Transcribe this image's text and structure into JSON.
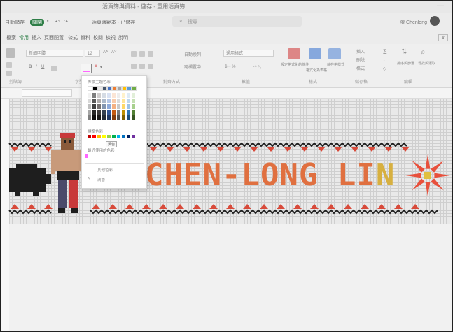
{
  "window": {
    "title": "活頁簿與資料 - 儲存 - 重用活頁簿"
  },
  "quickbar": {
    "autosave": "自動儲存",
    "toggle": "關閉",
    "filename": "活頁簿範本 - 已儲存",
    "search_placeholder": "搜尋",
    "user": "陳 Chenlong"
  },
  "tabs": [
    "檔案",
    "常用",
    "插入",
    "頁面配置",
    "公式",
    "資料",
    "校閱",
    "檢視",
    "說明"
  ],
  "ribbon": {
    "font_name": "新細明體",
    "font_size": "12",
    "number_format": "通用格式",
    "groups": [
      "剪貼簿",
      "字型",
      "對齊方式",
      "數值",
      "樣式",
      "儲存格",
      "編輯"
    ],
    "wrap_text": "自動換列",
    "merge": "跨欄置中",
    "cond_format": "設定格式化的條件",
    "format_table": "格式化為表格",
    "cell_styles": "儲存格樣式",
    "insert": "插入",
    "delete": "刪除",
    "format": "格式",
    "sort_filter": "排序與篩選",
    "find_select": "尋找與選取"
  },
  "color_panel": {
    "theme_colors_label": "佈景主題色彩",
    "standard_colors_label": "標準色彩",
    "recent_colors_label": "最近使用的色彩",
    "tooltip": "黃色",
    "more_colors": "其他色彩...",
    "eyedropper": "滴管",
    "theme_colors": [
      "#ffffff",
      "#000000",
      "#e7e6e6",
      "#44546a",
      "#4472c4",
      "#ed7d31",
      "#a5a5a5",
      "#ffc000",
      "#5b9bd5",
      "#70ad47"
    ],
    "shade_columns": [
      [
        "#f2f2f2",
        "#d9d9d9",
        "#bfbfbf",
        "#a6a6a6",
        "#808080"
      ],
      [
        "#7f7f7f",
        "#595959",
        "#404040",
        "#262626",
        "#0d0d0d"
      ],
      [
        "#d0cece",
        "#aeaaaa",
        "#757171",
        "#3a3838",
        "#171616"
      ],
      [
        "#d6dce4",
        "#adb9ca",
        "#8496b0",
        "#333f4f",
        "#222a35"
      ],
      [
        "#d9e2f3",
        "#b4c6e7",
        "#8eaadb",
        "#2f5496",
        "#1f3864"
      ],
      [
        "#fbe5d5",
        "#f7cbac",
        "#f4b183",
        "#c55a11",
        "#833c0b"
      ],
      [
        "#ededed",
        "#dbdbdb",
        "#c9c9c9",
        "#7b7b7b",
        "#525252"
      ],
      [
        "#fff2cc",
        "#fee599",
        "#ffd966",
        "#bf9000",
        "#7f6000"
      ],
      [
        "#deebf6",
        "#bdd7ee",
        "#9dc3e6",
        "#2e75b5",
        "#1e4e79"
      ],
      [
        "#e2efd9",
        "#c5e0b3",
        "#a8d08d",
        "#538135",
        "#375623"
      ]
    ],
    "standard_colors": [
      "#c00000",
      "#ff0000",
      "#ffc000",
      "#ffff00",
      "#92d050",
      "#00b050",
      "#00b0f0",
      "#0070c0",
      "#002060",
      "#7030a0"
    ],
    "recent_colors": [
      "#ff66ff"
    ]
  },
  "artwork": {
    "name_text_before": "CHEN-LONG LI",
    "name_text_highlight": "N",
    "text_color": "#e07040",
    "pattern_red": "#d84a3a",
    "pattern_black": "#1e1e1e",
    "star_color": "#e8503c",
    "star_center": "#e0c040"
  }
}
